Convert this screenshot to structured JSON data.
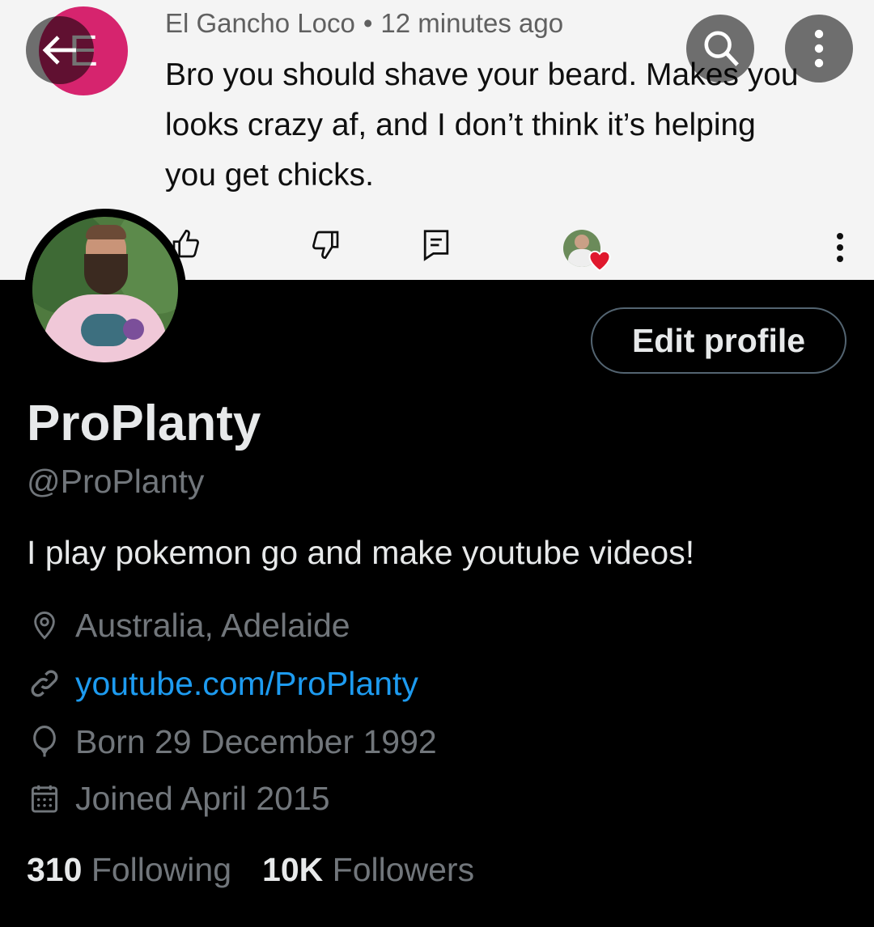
{
  "comment": {
    "author_initial": "E",
    "author": "El Gancho Loco",
    "separator": "•",
    "time": "12 minutes ago",
    "text": "Bro you should shave your beard. Makes you looks crazy af, and I don’t think it’s helping you get chicks.",
    "avatar_color": "#d6246e"
  },
  "header_buttons": {
    "back_icon": "arrow-left-icon",
    "search_icon": "search-icon",
    "more_icon": "more-vertical-icon"
  },
  "profile": {
    "edit_button": "Edit profile",
    "name": "ProPlanty",
    "handle": "@ProPlanty",
    "bio": "I play pokemon go and make youtube videos!",
    "location": "Australia, Adelaide",
    "website": "youtube.com/ProPlanty",
    "born": "Born 29 December 1992",
    "joined": "Joined April 2015",
    "following_count": "310",
    "following_label": "Following",
    "followers_count": "10K",
    "followers_label": "Followers"
  },
  "colors": {
    "accent_link": "#1d9bf0",
    "background": "#000000",
    "primary_text": "#e7e9ea",
    "secondary_text": "#71767b"
  }
}
